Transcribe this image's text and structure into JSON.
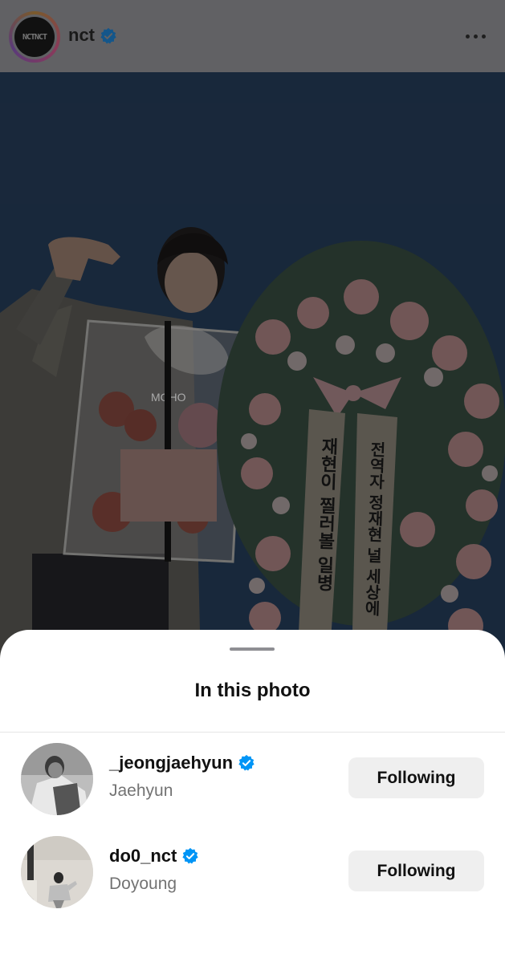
{
  "header": {
    "account_name": "nct",
    "avatar_logo_text": "NCTNCT",
    "verified_icon": "verified-badge-icon",
    "more_icon": "more-horizontal-icon"
  },
  "photo": {
    "banner_left": [
      "재현이",
      "찔러볼",
      "일병"
    ],
    "banner_right": [
      "전역자",
      "정재현",
      "널",
      "세상에"
    ],
    "cake_text": "MOHO"
  },
  "sheet": {
    "title": "In this photo",
    "people": [
      {
        "username": "_jeongjaehyun",
        "full_name": "Jaehyun",
        "button": "Following"
      },
      {
        "username": "do0_nct",
        "full_name": "Doyoung",
        "button": "Following"
      }
    ]
  },
  "colors": {
    "dim_overlay": "#616164",
    "wall_blue": "#1c2e44",
    "verified_blue": "#0095f6",
    "button_bg": "#efefef"
  }
}
